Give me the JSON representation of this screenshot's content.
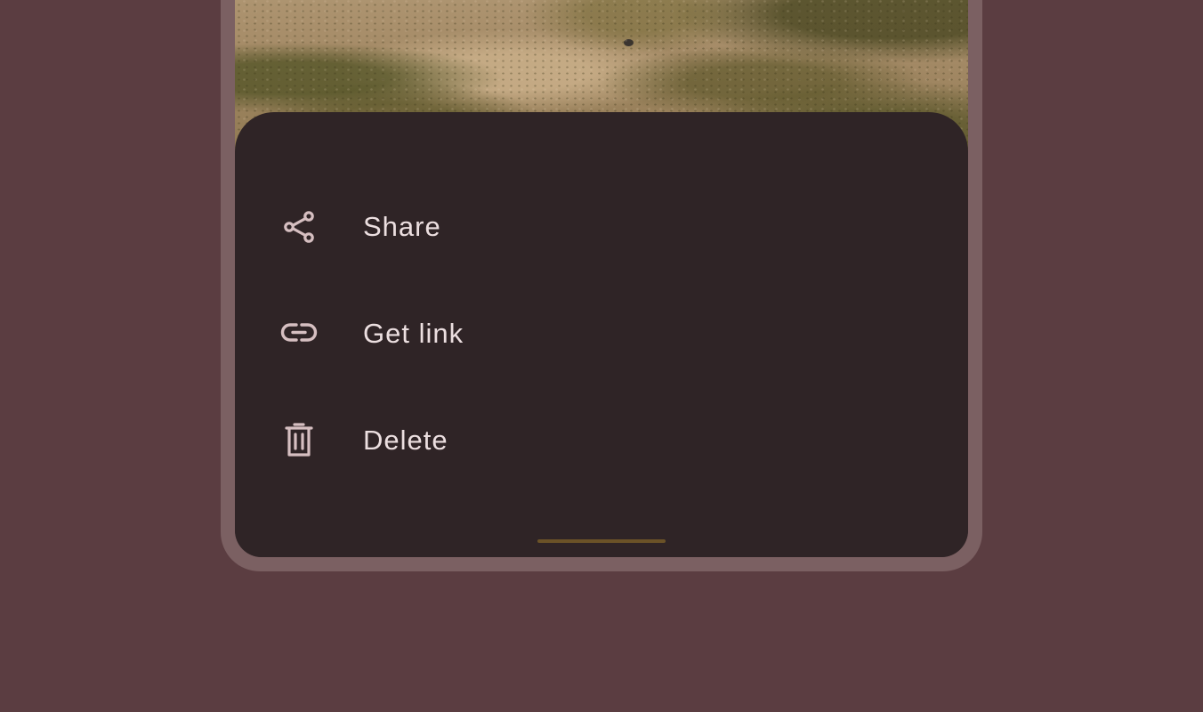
{
  "colors": {
    "background": "#5b3d41",
    "device_frame": "#7b6062",
    "sheet": "#2f2426",
    "text": "#ecdfe0",
    "icon": "#d6bfc1",
    "handle": "#6b5227"
  },
  "bottom_sheet": {
    "items": [
      {
        "label": "Share",
        "icon": "share-icon"
      },
      {
        "label": "Get link",
        "icon": "link-icon"
      },
      {
        "label": "Delete",
        "icon": "trash-icon"
      }
    ]
  }
}
